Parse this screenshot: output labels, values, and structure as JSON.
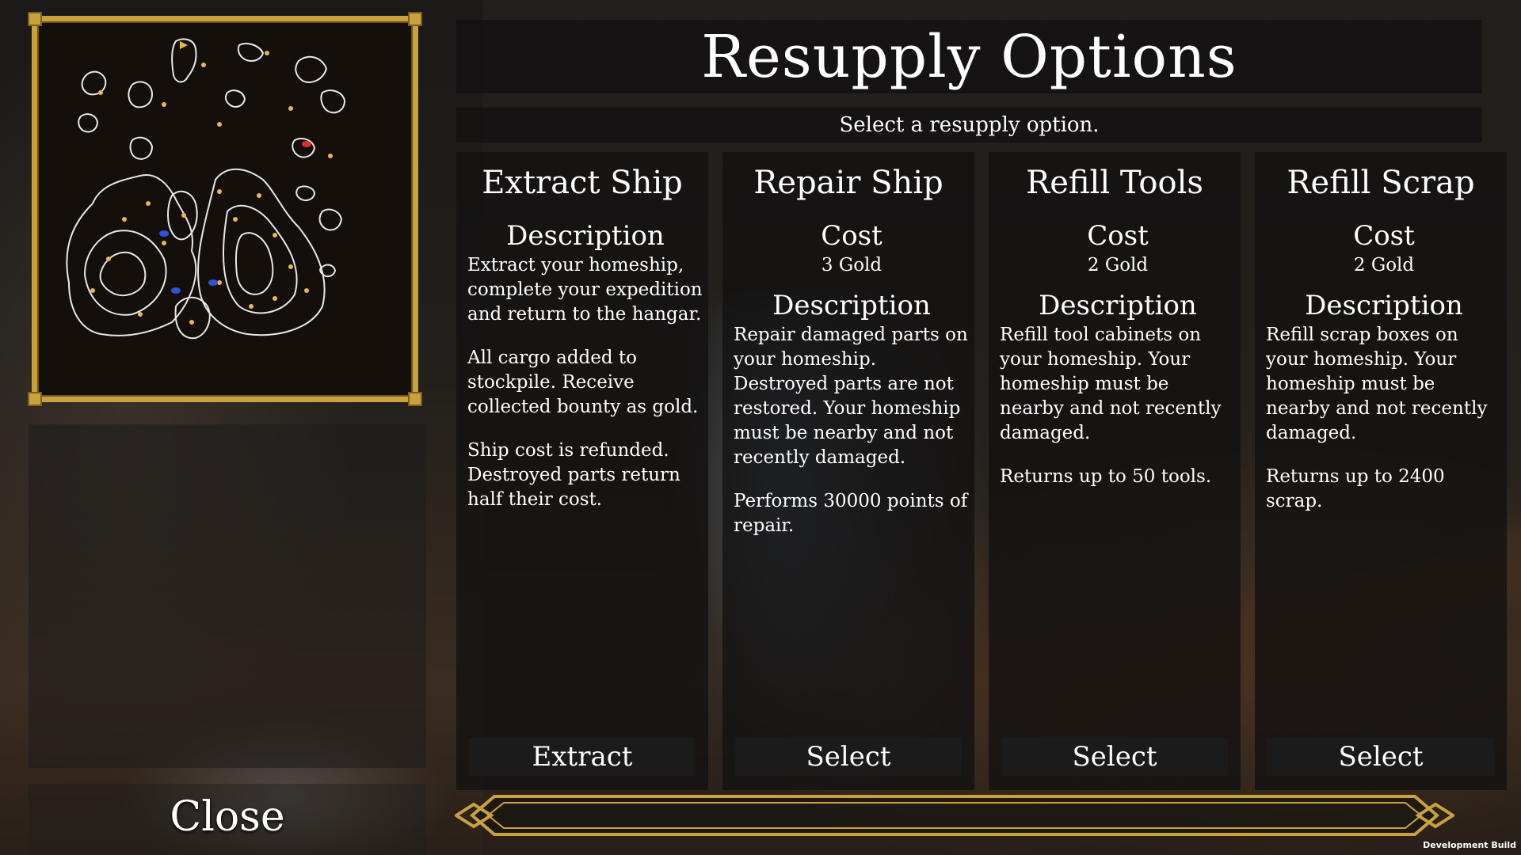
{
  "page_title": "Resupply Options",
  "subtitle": "Select a resupply option.",
  "close_label": "Close",
  "dev_build_label": "Development Build",
  "colors": {
    "frame_gold": "#c9a23c",
    "panel_bg": "#121111"
  },
  "icons": {
    "map": "world-map-icon",
    "ornament": "gold-ornament-bar"
  },
  "options": [
    {
      "title": "Extract Ship",
      "desc_heading": "Description",
      "desc_p1": "Extract your homeship, complete your expedition and return to the hangar.",
      "desc_p2": "All cargo added to stockpile. Receive collected bounty as gold.",
      "desc_p3": "Ship cost is refunded. Destroyed parts return half their cost.",
      "button": "Extract"
    },
    {
      "title": "Repair Ship",
      "cost_heading": "Cost",
      "cost_value": "3 Gold",
      "desc_heading": "Description",
      "desc_p1": "Repair damaged parts on your homeship. Destroyed parts are not restored. Your homeship must be nearby and not recently damaged.",
      "desc_p2": "Performs 30000 points of repair.",
      "button": "Select"
    },
    {
      "title": "Refill Tools",
      "cost_heading": "Cost",
      "cost_value": "2 Gold",
      "desc_heading": "Description",
      "desc_p1": "Refill tool cabinets on your homeship. Your homeship must be nearby and not recently damaged.",
      "desc_p2": "Returns up to 50 tools.",
      "button": "Select"
    },
    {
      "title": "Refill Scrap",
      "cost_heading": "Cost",
      "cost_value": "2 Gold",
      "desc_heading": "Description",
      "desc_p1": "Refill scrap boxes on your homeship. Your homeship must be nearby and not recently damaged.",
      "desc_p2": "Returns up to 2400 scrap.",
      "button": "Select"
    }
  ]
}
